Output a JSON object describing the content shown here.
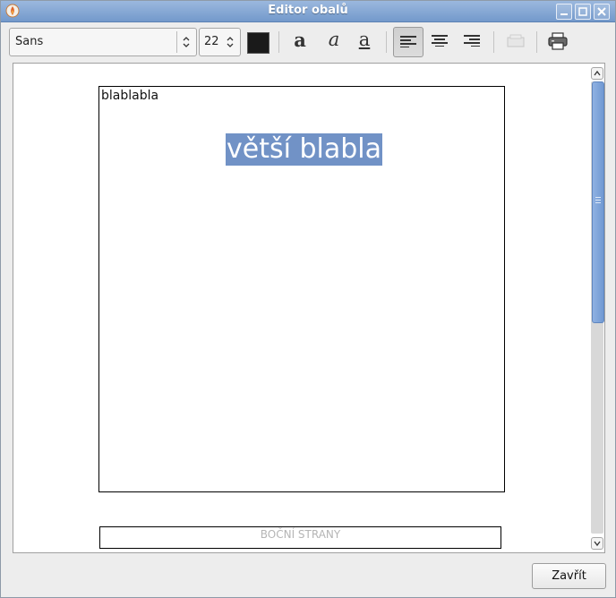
{
  "window": {
    "title": "Editor obalů"
  },
  "toolbar": {
    "font_family": "Sans",
    "font_size": "22",
    "text_color": "#1a1a1a",
    "buttons": [
      {
        "name": "bold-icon",
        "glyph": "a"
      },
      {
        "name": "italic-icon",
        "glyph": "a"
      },
      {
        "name": "underline-icon",
        "glyph": "a"
      }
    ],
    "align_left_active": true
  },
  "editor": {
    "small_text": "blablabla",
    "big_text": "větší blabla",
    "selection_color": "#7192c6",
    "side_label": "BOČNÍ STRANY"
  },
  "footer": {
    "close_label": "Zavřít"
  }
}
